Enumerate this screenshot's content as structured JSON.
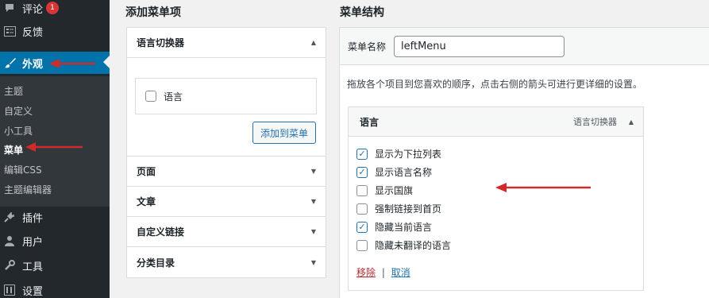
{
  "sidebar": {
    "comments_label": "评论",
    "comments_badge": "1",
    "feedback_label": "反馈",
    "appearance_label": "外观",
    "submenu": {
      "themes": "主题",
      "customize": "自定义",
      "widgets": "小工具",
      "menus": "菜单",
      "edit_css": "编辑CSS",
      "theme_editor": "主题编辑器"
    },
    "plugins_label": "插件",
    "users_label": "用户",
    "tools_label": "工具",
    "settings_label": "设置"
  },
  "add_items": {
    "heading": "添加菜单项",
    "language_switcher": {
      "title": "语言切换器",
      "option_label": "语言",
      "add_button": "添加到菜单"
    },
    "sections": [
      "页面",
      "文章",
      "自定义链接",
      "分类目录"
    ]
  },
  "menu_structure": {
    "heading": "菜单结构",
    "name_label": "菜单名称",
    "name_value": "leftMenu",
    "hint": "拖放各个项目到您喜欢的顺序，点击右侧的箭头可进行更详细的设置。",
    "item": {
      "title": "语言",
      "type": "语言切换器",
      "options": [
        {
          "label": "显示为下拉列表",
          "checked": true
        },
        {
          "label": "显示语言名称",
          "checked": true
        },
        {
          "label": "显示国旗",
          "checked": false
        },
        {
          "label": "强制链接到首页",
          "checked": false
        },
        {
          "label": "隐藏当前语言",
          "checked": true
        },
        {
          "label": "隐藏未翻译的语言",
          "checked": false
        }
      ],
      "remove_label": "移除",
      "separator": "|",
      "cancel_label": "取消"
    }
  },
  "colors": {
    "sidebar_bg": "#23282d",
    "active_bg": "#0073aa",
    "annotation_arrow": "#d12a2a"
  }
}
